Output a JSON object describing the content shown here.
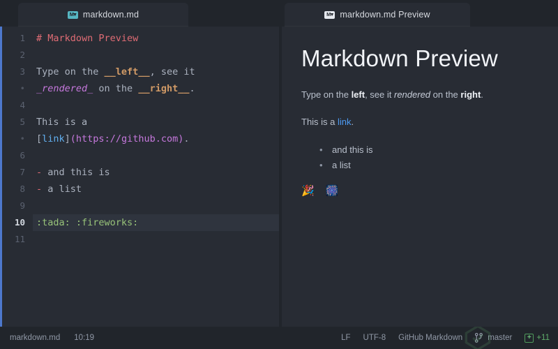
{
  "theme": {
    "window_bg": "#21252b",
    "pane_bg": "#282c34",
    "accent_blue": "#4d78cc",
    "active_line_bg": "#2f343e",
    "status_green": "#6cc07a"
  },
  "tabs": [
    {
      "label": "markdown.md",
      "icon": "markdown-icon",
      "icon_style": "teal",
      "active": true
    },
    {
      "label": "markdown.md Preview",
      "icon": "markdown-icon",
      "icon_style": "white",
      "active": false
    }
  ],
  "editor": {
    "language": "GitHub Markdown",
    "lines": [
      {
        "number": "1",
        "wrapped": false,
        "active": false,
        "tokens": [
          {
            "t": "# Markdown Preview",
            "c": "s-head"
          }
        ]
      },
      {
        "number": "2",
        "wrapped": false,
        "active": false,
        "tokens": []
      },
      {
        "number": "3",
        "wrapped": false,
        "active": false,
        "tokens": [
          {
            "t": "Type on the ",
            "c": "s-text"
          },
          {
            "t": "__left__",
            "c": "s-bold"
          },
          {
            "t": ", see it",
            "c": "s-text"
          }
        ]
      },
      {
        "number": "•",
        "wrapped": true,
        "active": false,
        "tokens": [
          {
            "t": "_rendered_",
            "c": "s-ital"
          },
          {
            "t": " on the ",
            "c": "s-text"
          },
          {
            "t": "__right__",
            "c": "s-bold"
          },
          {
            "t": ".",
            "c": "s-text"
          }
        ]
      },
      {
        "number": "4",
        "wrapped": false,
        "active": false,
        "tokens": []
      },
      {
        "number": "5",
        "wrapped": false,
        "active": false,
        "tokens": [
          {
            "t": "This is a",
            "c": "s-text"
          }
        ]
      },
      {
        "number": "•",
        "wrapped": true,
        "active": false,
        "tokens": [
          {
            "t": "[",
            "c": "s-brack"
          },
          {
            "t": "link",
            "c": "s-link"
          },
          {
            "t": "]",
            "c": "s-brack"
          },
          {
            "t": "(https://github.com)",
            "c": "s-url"
          },
          {
            "t": ".",
            "c": "s-text"
          }
        ]
      },
      {
        "number": "6",
        "wrapped": false,
        "active": false,
        "tokens": []
      },
      {
        "number": "7",
        "wrapped": false,
        "active": false,
        "tokens": [
          {
            "t": "- ",
            "c": "s-bullet"
          },
          {
            "t": "and this is",
            "c": "s-text"
          }
        ]
      },
      {
        "number": "8",
        "wrapped": false,
        "active": false,
        "tokens": [
          {
            "t": "- ",
            "c": "s-bullet"
          },
          {
            "t": "a list",
            "c": "s-text"
          }
        ]
      },
      {
        "number": "9",
        "wrapped": false,
        "active": false,
        "tokens": []
      },
      {
        "number": "10",
        "wrapped": false,
        "active": true,
        "tokens": [
          {
            "t": ":tada: :fireworks:",
            "c": "s-emoji"
          }
        ]
      },
      {
        "number": "11",
        "wrapped": false,
        "active": false,
        "tokens": []
      }
    ]
  },
  "preview": {
    "heading": "Markdown Preview",
    "paragraph1": [
      {
        "t": "Type on the ",
        "style": "plain"
      },
      {
        "t": "left",
        "style": "bold"
      },
      {
        "t": ", see it ",
        "style": "plain"
      },
      {
        "t": "rendered",
        "style": "italic"
      },
      {
        "t": " on the ",
        "style": "plain"
      },
      {
        "t": "right",
        "style": "bold"
      },
      {
        "t": ".",
        "style": "plain"
      }
    ],
    "paragraph2": [
      {
        "t": "This is a ",
        "style": "plain"
      },
      {
        "t": "link",
        "style": "link"
      },
      {
        "t": ".",
        "style": "plain"
      }
    ],
    "list": [
      "and this is",
      "a list"
    ],
    "emoji": "🎉 🎆"
  },
  "statusbar": {
    "filename": "markdown.md",
    "cursor_position": "10:19",
    "line_ending": "LF",
    "encoding": "UTF-8",
    "grammar": "GitHub Markdown",
    "branch_icon": "git-branch-icon",
    "branch": "master",
    "diff_icon": "plus-box-icon",
    "diff_added": "+11"
  }
}
